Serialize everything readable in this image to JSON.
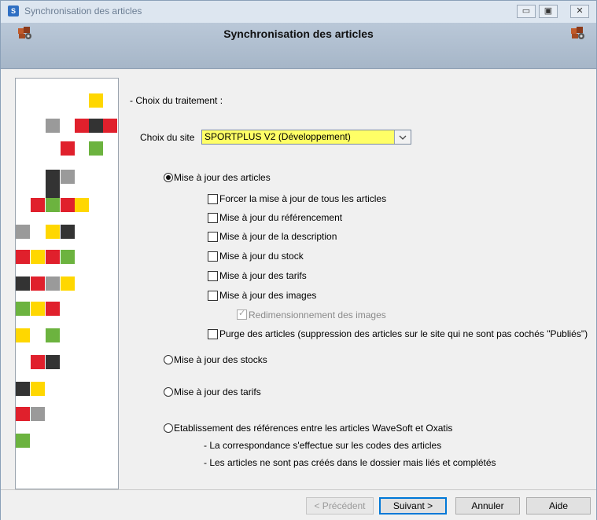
{
  "window": {
    "title": "Synchronisation des articles",
    "controls": [
      "▭",
      "▣",
      "✕"
    ]
  },
  "header": {
    "title": "Synchronisation des articles"
  },
  "section_label": "- Choix du traitement :",
  "site": {
    "label": "Choix du site",
    "value": "SPORTPLUS V2 (Développement)"
  },
  "options": {
    "update_articles": "Mise à jour des articles",
    "checkboxes": [
      "Forcer la mise à jour de tous les articles",
      "Mise à jour du référencement",
      "Mise à jour de la description",
      "Mise à jour du stock",
      "Mise à jour des tarifs",
      "Mise à jour des images"
    ],
    "resize_images": "Redimensionnement des images",
    "purge": "Purge des articles (suppression des articles sur le site qui ne sont pas cochés \"Publiés\")",
    "update_stocks": "Mise à jour des stocks",
    "update_prices": "Mise à jour des tarifs",
    "references": "Etablissement des références entre les articles WaveSoft et Oxatis",
    "note1": "- La correspondance s'effectue sur les codes des articles",
    "note2": "- Les articles ne sont pas créés dans le dossier mais liés et complétés"
  },
  "buttons": {
    "previous": "< Précédent",
    "next": "Suivant >",
    "cancel": "Annuler",
    "help": "Aide"
  },
  "colors": {
    "yellow": "#ffd700",
    "red": "#e0202c",
    "green": "#6cb33f",
    "gray": "#9a9a9a",
    "dark": "#333333",
    "combo_bg": "#ffff66"
  }
}
